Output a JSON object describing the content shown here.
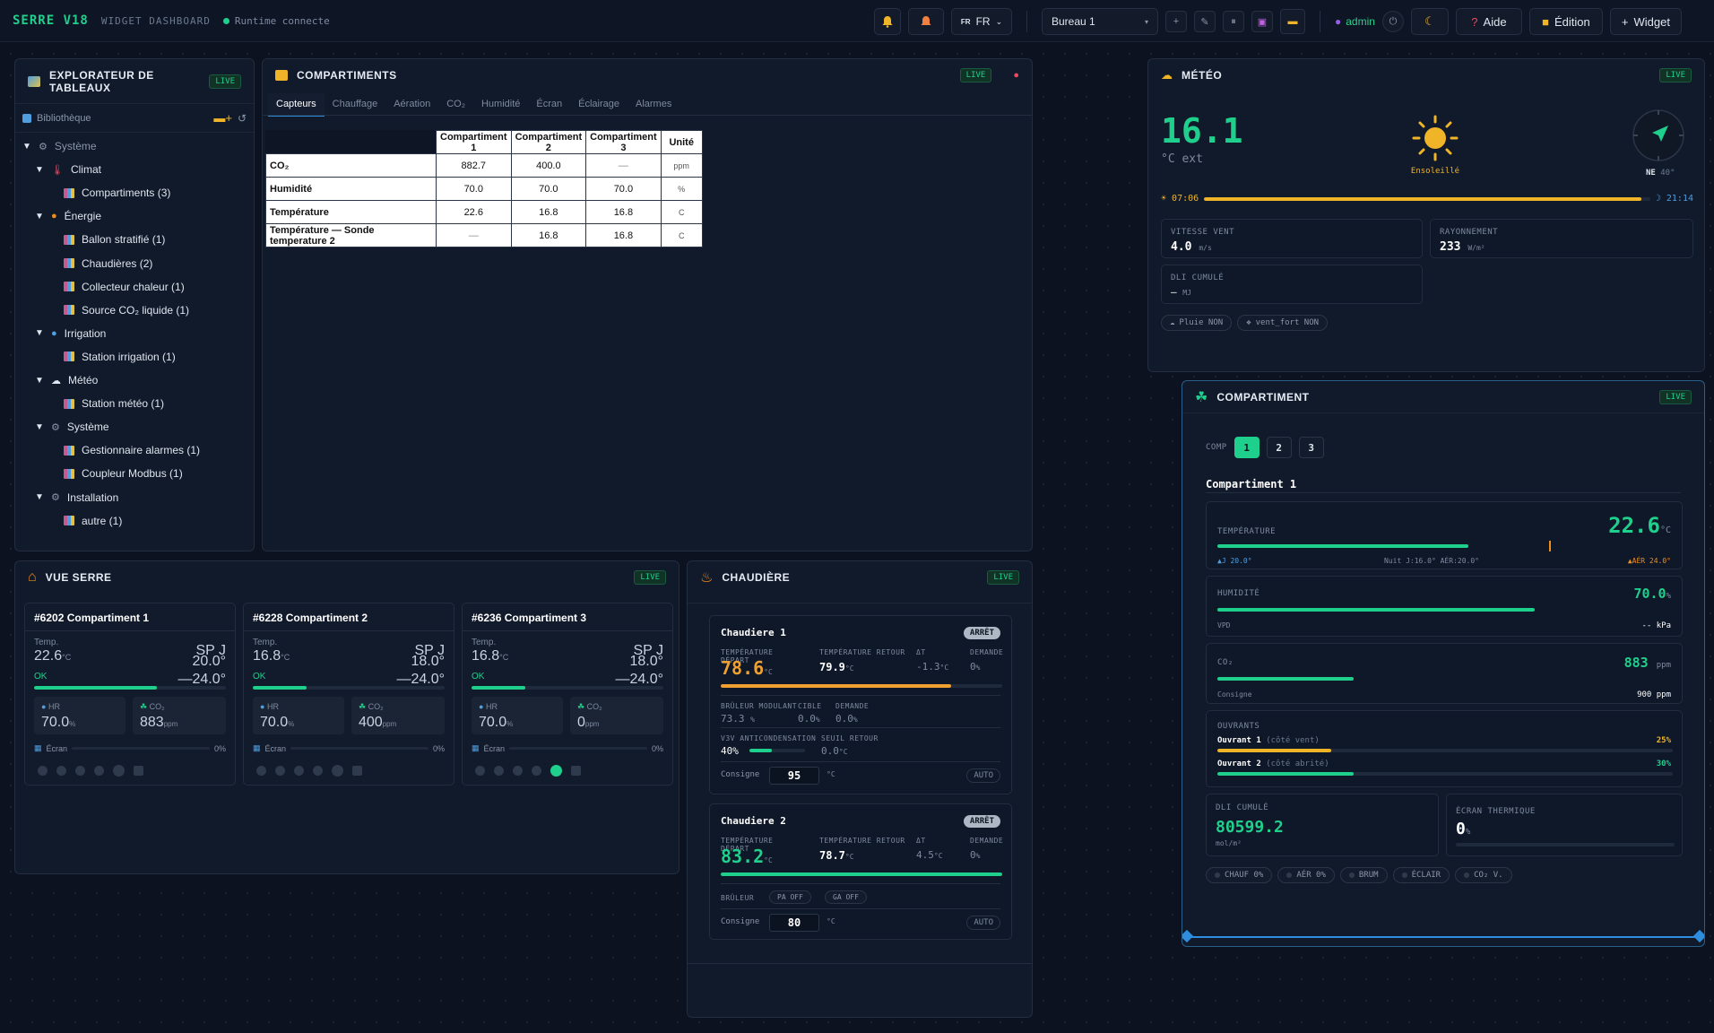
{
  "topbar": {
    "brand": "SERRE V18",
    "subtitle": "WIDGET DASHBOARD",
    "runtime": "Runtime connecte",
    "lang": "FR",
    "lang_flag": "FR",
    "board": "Bureau 1",
    "user": "admin",
    "help": "Aide",
    "edit": "Édition",
    "widget": "Widget"
  },
  "explorer": {
    "title": "EXPLORATEUR DE TABLEAUX",
    "live": "LIVE",
    "library": "Bibliothèque",
    "rows": [
      "Système",
      "Climat",
      "Compartiments (3)",
      "Énergie",
      "Ballon stratifié (1)",
      "Chaudières (2)",
      "Collecteur chaleur (1)",
      "Source CO₂ liquide (1)",
      "Irrigation",
      "Station irrigation (1)",
      "Météo",
      "Station météo (1)",
      "Système",
      "Gestionnaire alarmes (1)",
      "Coupleur Modbus (1)",
      "Installation",
      "autre (1)"
    ]
  },
  "comps": {
    "title": "COMPARTIMENTS",
    "live": "LIVE",
    "tabs": [
      "Capteurs",
      "Chauffage",
      "Aération",
      "CO₂",
      "Humidité",
      "Écran",
      "Éclairage",
      "Alarmes"
    ],
    "headers": [
      "",
      "Compartiment 1",
      "Compartiment 2",
      "Compartiment 3",
      "Unité"
    ],
    "rows": [
      [
        "CO₂",
        "882.7",
        "400.0",
        "—",
        "ppm"
      ],
      [
        "Humidité",
        "70.0",
        "70.0",
        "70.0",
        "%"
      ],
      [
        "Température",
        "22.6",
        "16.8",
        "16.8",
        "C"
      ],
      [
        "Température — Sonde temperature 2",
        "—",
        "16.8",
        "16.8",
        "C"
      ]
    ]
  },
  "meteo": {
    "title": "MÉTÉO",
    "live": "LIVE",
    "temp": "16.1",
    "unit": "°C ext",
    "cond": "Ensoleillé",
    "dir": "NE",
    "deg": "40°",
    "sunrise": "07:06",
    "sunset": "21:14",
    "sun_progress": 0.98,
    "wind_lbl": "VITESSE VENT",
    "wind": "4.0",
    "wind_u": "m/s",
    "ray_lbl": "RAYONNEMENT",
    "ray": "233",
    "ray_u": "W/m²",
    "dli_lbl": "DLI CUMULÉ",
    "dli": "—",
    "dli_u": "MJ",
    "rain": "Pluie NON",
    "strong": "vent_fort NON"
  },
  "comp": {
    "title": "COMPARTIMENT",
    "live": "LIVE",
    "comp_lbl": "COMP",
    "btns": [
      "1",
      "2",
      "3"
    ],
    "name": "Compartiment 1",
    "temp_lbl": "TEMPÉRATURE",
    "temp": "22.6",
    "temp_u": "°C",
    "temp_left": "▲J 20.0°",
    "temp_mid": "Nuit J:16.0° AÉR:20.0°",
    "temp_right": "▲AÉR 24.0°",
    "hum_lbl": "HUMIDITÉ",
    "hum": "70.0",
    "hum_u": "%",
    "vpd_lbl": "VPD",
    "vpd": "-- kPa",
    "co2_lbl": "CO₂",
    "co2": "883",
    "co2_u": "ppm",
    "cons_lbl": "Consigne",
    "cons": "900 ppm",
    "ouv_lbl": "OUVRANTS",
    "ouv1": "Ouvrant 1",
    "ouv1_s": "(côté vent)",
    "ouv1_v": "25%",
    "ouv2": "Ouvrant 2",
    "ouv2_s": "(côté abrité)",
    "ouv2_v": "30%",
    "dli_lbl": "DLI CUMULÉ",
    "dli": "80599.2",
    "dli_u": "mol/m²",
    "ecr_lbl": "ÉCRAN THERMIQUE",
    "ecr": "0",
    "ecr_u": "%",
    "chips": [
      "CHAUF 0%",
      "AÉR 0%",
      "BRUM",
      "ÉCLAIR",
      "CO₂ V."
    ]
  },
  "vue": {
    "title": "VUE SERRE",
    "live": "LIVE",
    "cards": [
      {
        "name": "#6202 Compartiment 1",
        "temp": "22.6",
        "sp": "20.0°",
        "sp2": "—24.0°",
        "hr": "70.0",
        "co2": "883",
        "ecran": "0%"
      },
      {
        "name": "#6228 Compartiment 2",
        "temp": "16.8",
        "sp": "18.0°",
        "sp2": "—24.0°",
        "hr": "70.0",
        "co2": "400",
        "ecran": "0%"
      },
      {
        "name": "#6236 Compartiment 3",
        "temp": "16.8",
        "sp": "18.0°",
        "sp2": "—24.0°",
        "hr": "70.0",
        "co2": "0",
        "ecran": "0%"
      }
    ],
    "temp_lbl": "Temp.",
    "temp_u": "°C",
    "sp_lbl": "SP J",
    "ok": "OK",
    "hr_lbl": "HR",
    "co2_lbl": "CO₂",
    "hr_u": "%",
    "co2_u": "ppm",
    "ecran_lbl": "Écran"
  },
  "chaud": {
    "title": "CHAUDIÈRE",
    "live": "LIVE",
    "c1": {
      "name": "Chaudiere 1",
      "state": "ARRÊT",
      "dep": "78.6",
      "ret": "79.9",
      "dt": "-1.3",
      "dem": "0",
      "brul": "73.3",
      "cible": "0.0",
      "dem2": "0.0",
      "v3v": "40%",
      "seuil": "0.0",
      "cons": "95"
    },
    "c2": {
      "name": "Chaudiere 2",
      "state": "ARRÊT",
      "dep": "83.2",
      "ret": "78.7",
      "dt": "4.5",
      "dem": "0",
      "pa": "PA OFF",
      "ga": "GA OFF",
      "cons": "80"
    },
    "l_dep": "TEMPÉRATURE DÉPART",
    "l_ret": "TEMPÉRATURE RETOUR",
    "l_dt": "ΔT",
    "l_dem": "DEMANDE",
    "l_brul": "BRÛLEUR MODULANT",
    "l_cible": "CIBLE",
    "l_dem2": "DEMANDE",
    "l_v3v": "V3V ANTICONDENSATION",
    "l_seuil": "SEUIL RETOUR",
    "l_brul2": "BRÛLEUR",
    "l_cons": "Consigne",
    "auto": "AUTO",
    "u_c": "°C",
    "u_pc": "%"
  }
}
